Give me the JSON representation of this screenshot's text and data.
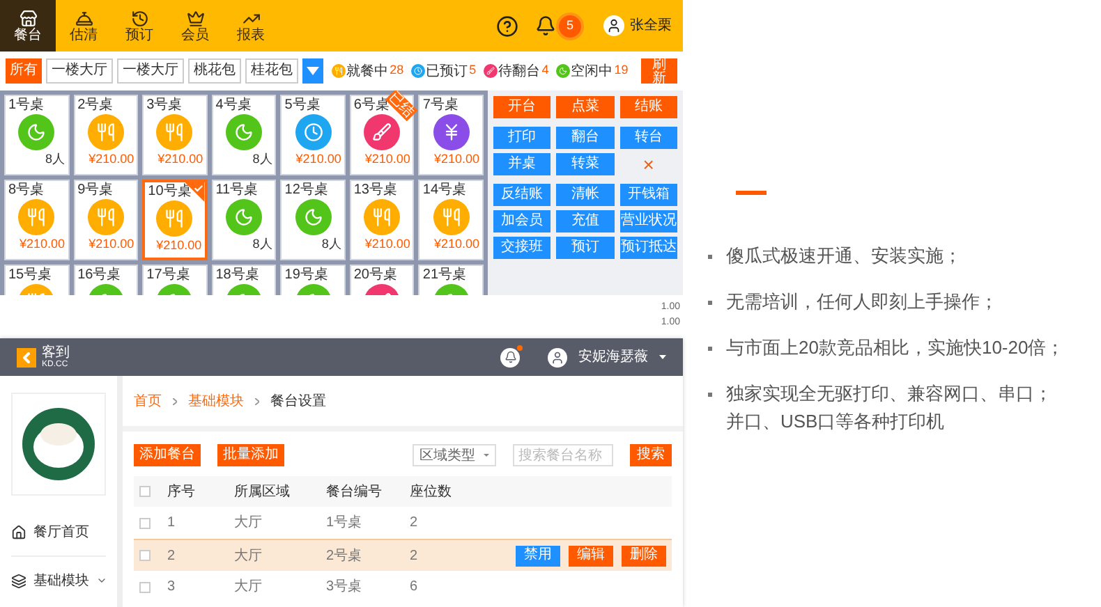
{
  "pos_screen": {
    "nav": [
      {
        "label": "餐台",
        "selected": true
      },
      {
        "label": "估清",
        "selected": false
      },
      {
        "label": "预订",
        "selected": false
      },
      {
        "label": "会员",
        "selected": false
      },
      {
        "label": "报表",
        "selected": false
      }
    ],
    "notification_count": "5",
    "user_name": "张全栗",
    "area_filters": [
      {
        "label": "所有",
        "selected": true
      },
      {
        "label": "一楼大厅",
        "selected": false
      },
      {
        "label": "一楼大厅",
        "selected": false
      },
      {
        "label": "桃花包",
        "selected": false
      },
      {
        "label": "桂花包",
        "selected": false
      }
    ],
    "legend": [
      {
        "label": "就餐中",
        "count": "28",
        "kind": "dining"
      },
      {
        "label": "已预订",
        "count": "5",
        "kind": "reserved"
      },
      {
        "label": "待翻台",
        "count": "4",
        "kind": "cleaning"
      },
      {
        "label": "空闲中",
        "count": "19",
        "kind": "idle"
      }
    ],
    "refresh": "刷新",
    "tables": [
      {
        "name": "1号桌",
        "kind": "idle",
        "footer": "8人",
        "selected": false
      },
      {
        "name": "2号桌",
        "kind": "dining",
        "footer": "¥210.00",
        "selected": false
      },
      {
        "name": "3号桌",
        "kind": "dining",
        "footer": "¥210.00",
        "selected": false
      },
      {
        "name": "4号桌",
        "kind": "idle",
        "footer": "8人",
        "selected": false
      },
      {
        "name": "5号桌",
        "kind": "reserved",
        "footer": "¥210.00",
        "selected": false
      },
      {
        "name": "6号桌",
        "kind": "cleaning",
        "footer": "¥210.00",
        "selected": false,
        "badge": "已结"
      },
      {
        "name": "7号桌",
        "kind": "paying",
        "footer": "¥210.00",
        "selected": false
      },
      {
        "name": "8号桌",
        "kind": "dining",
        "footer": "¥210.00",
        "selected": false
      },
      {
        "name": "9号桌",
        "kind": "dining",
        "footer": "¥210.00",
        "selected": false
      },
      {
        "name": "10号桌",
        "kind": "dining",
        "footer": "¥210.00",
        "selected": true
      },
      {
        "name": "11号桌",
        "kind": "idle",
        "footer": "8人",
        "selected": false
      },
      {
        "name": "12号桌",
        "kind": "idle",
        "footer": "8人",
        "selected": false
      },
      {
        "name": "13号桌",
        "kind": "dining",
        "footer": "¥210.00",
        "selected": false
      },
      {
        "name": "14号桌",
        "kind": "dining",
        "footer": "¥210.00",
        "selected": false
      },
      {
        "name": "15号桌",
        "kind": "dining",
        "selected": false
      },
      {
        "name": "16号桌",
        "kind": "idle",
        "selected": false
      },
      {
        "name": "17号桌",
        "kind": "idle",
        "selected": false
      },
      {
        "name": "18号桌",
        "kind": "idle",
        "selected": false
      },
      {
        "name": "19号桌",
        "kind": "idle",
        "selected": false
      },
      {
        "name": "20号桌",
        "kind": "cleaning",
        "selected": false
      },
      {
        "name": "21号桌",
        "kind": "idle",
        "selected": false
      }
    ],
    "action_groups": [
      [
        {
          "label": "开台",
          "kind": "primary"
        },
        {
          "label": "点菜",
          "kind": "primary"
        },
        {
          "label": "结账",
          "kind": "primary"
        }
      ],
      [
        {
          "label": "打印",
          "kind": "secondary"
        },
        {
          "label": "翻台",
          "kind": "secondary"
        },
        {
          "label": "转台",
          "kind": "secondary"
        },
        {
          "label": "并桌",
          "kind": "secondary"
        },
        {
          "label": "转菜",
          "kind": "secondary"
        },
        {
          "label": "×",
          "kind": "close"
        }
      ],
      [
        {
          "label": "反结账",
          "kind": "secondary"
        },
        {
          "label": "清帐",
          "kind": "secondary"
        },
        {
          "label": "开钱箱",
          "kind": "secondary"
        },
        {
          "label": "加会员",
          "kind": "secondary"
        },
        {
          "label": "充值",
          "kind": "secondary"
        },
        {
          "label": "营业状况",
          "kind": "secondary"
        },
        {
          "label": "交接班",
          "kind": "secondary"
        },
        {
          "label": "预订",
          "kind": "secondary"
        },
        {
          "label": "预订抵达",
          "kind": "secondary"
        }
      ]
    ],
    "receipt_amounts": [
      "1.00",
      "1.00"
    ]
  },
  "admin_screen": {
    "brand": {
      "name": "客到",
      "domain": "KD.CC"
    },
    "new_notification": true,
    "user_name": "安妮海瑟薇",
    "sidebar": [
      {
        "label": "餐厅首页",
        "expandable": false
      },
      {
        "label": "基础模块",
        "expandable": true
      }
    ],
    "breadcrumb": [
      {
        "label": "首页",
        "link": true
      },
      {
        "label": "基础模块",
        "link": true
      },
      {
        "label": "餐台设置",
        "link": false
      }
    ],
    "toolbar_buttons": [
      "添加餐台",
      "批量添加"
    ],
    "area_select": "区域类型",
    "search": {
      "placeholder": "搜索餐台名称",
      "button": "搜索"
    },
    "table": {
      "select_all_checked": false,
      "columns": [
        "序号",
        "所属区域",
        "餐台编号",
        "座位数"
      ],
      "rows": [
        {
          "cells": [
            "1",
            "大厅",
            "1号桌",
            "2"
          ],
          "selected": false
        },
        {
          "cells": [
            "2",
            "大厅",
            "2号桌",
            "2"
          ],
          "selected": true,
          "actions": [
            {
              "label": "禁用",
              "kind": "secondary"
            },
            {
              "label": "编辑",
              "kind": "primary"
            },
            {
              "label": "删除",
              "kind": "primary"
            }
          ]
        },
        {
          "cells": [
            "3",
            "大厅",
            "3号桌",
            "6"
          ],
          "selected": false
        }
      ]
    }
  },
  "features": [
    "傻瓜式极速开通、安装实施；",
    "无需培训，任何人即刻上手操作；",
    "与市面上20款竞品相比，实施快10-20倍；",
    "独家实现全无驱打印、兼容网口、串口；并口、USB口等各种打印机"
  ]
}
